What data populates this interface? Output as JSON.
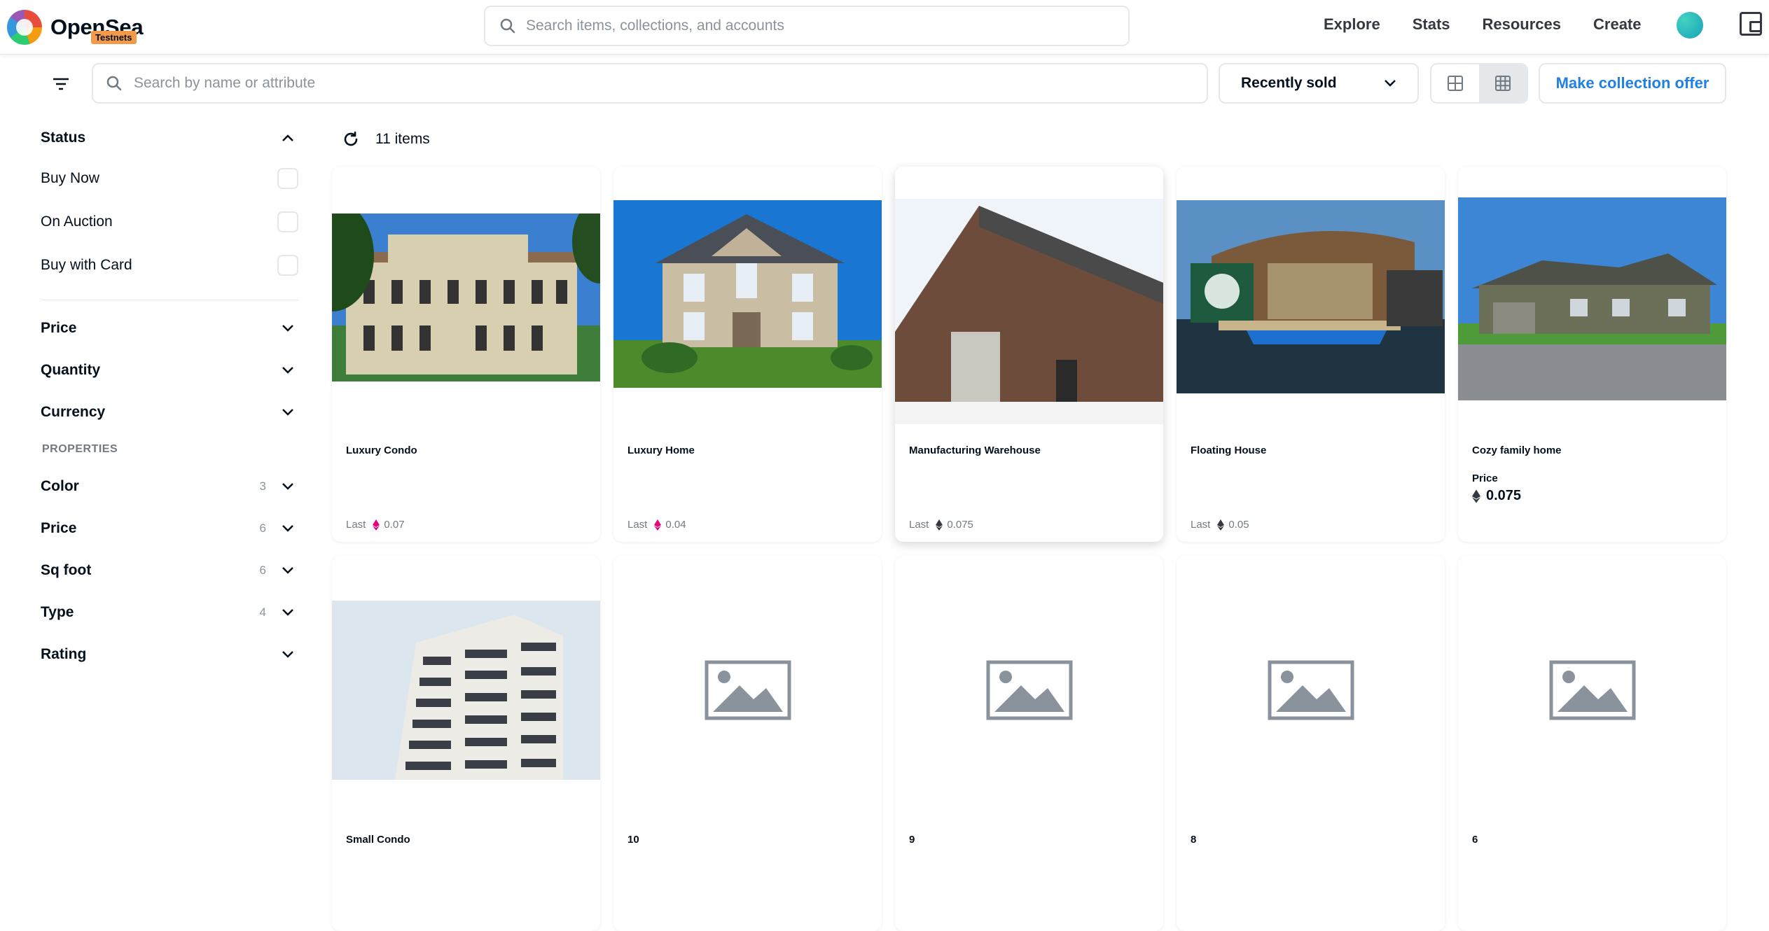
{
  "header": {
    "brand": "OpenSea",
    "badge": "Testnets",
    "search_placeholder": "Search items, collections, and accounts",
    "nav": [
      "Explore",
      "Stats",
      "Resources",
      "Create"
    ]
  },
  "toolbar": {
    "search_placeholder": "Search by name or attribute",
    "sort_value": "Recently sold",
    "offer_button": "Make collection offer"
  },
  "sidebar": {
    "status_title": "Status",
    "status_options": [
      "Buy Now",
      "On Auction",
      "Buy with Card"
    ],
    "filters": [
      "Price",
      "Quantity",
      "Currency"
    ],
    "properties_title": "PROPERTIES",
    "properties": [
      {
        "name": "Color",
        "count": "3"
      },
      {
        "name": "Price",
        "count": "6"
      },
      {
        "name": "Sq foot",
        "count": "6"
      },
      {
        "name": "Type",
        "count": "4"
      },
      {
        "name": "Rating",
        "count": ""
      }
    ]
  },
  "results": {
    "count_label": "11 items"
  },
  "cards": [
    {
      "title": "Luxury Condo",
      "last_label": "Last",
      "last_value": "0.07",
      "eth_color": "#e6007a"
    },
    {
      "title": "Luxury Home",
      "last_label": "Last",
      "last_value": "0.04",
      "eth_color": "#e6007a"
    },
    {
      "title": "Manufacturing Warehouse",
      "last_label": "Last",
      "last_value": "0.075",
      "eth_color": "#353840"
    },
    {
      "title": "Floating House",
      "last_label": "Last",
      "last_value": "0.05",
      "eth_color": "#353840"
    },
    {
      "title": "Cozy family home",
      "price_label": "Price",
      "price_value": "0.075"
    },
    {
      "title": "Small Condo"
    },
    {
      "title": "10"
    },
    {
      "title": "9"
    },
    {
      "title": "8"
    },
    {
      "title": "6"
    }
  ]
}
